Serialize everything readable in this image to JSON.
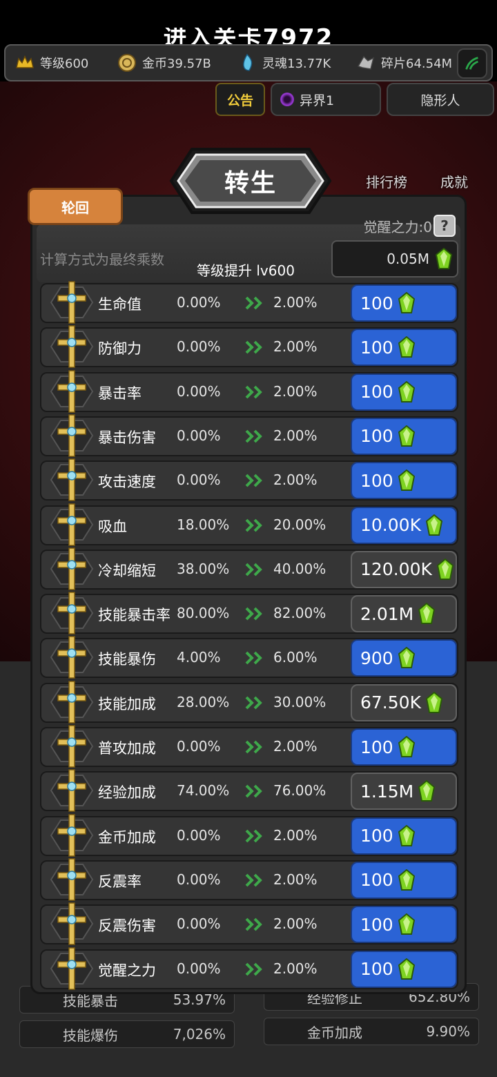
{
  "header": {
    "stage_title": "进入关卡7972"
  },
  "resources": [
    {
      "icon": "crown-icon",
      "label": "等级600"
    },
    {
      "icon": "gold-coin-icon",
      "label": "金币39.57B"
    },
    {
      "icon": "soul-icon",
      "label": "灵魂13.77K"
    },
    {
      "icon": "shard-icon",
      "label": "碎片64.54M"
    }
  ],
  "top_tabs": {
    "notice": "公告",
    "other_world": "异界1",
    "invisible": "隐形人"
  },
  "side": {
    "leaderboard": "排行榜",
    "achievement": "成就"
  },
  "panel": {
    "title": "转生",
    "tab": "轮回",
    "awaken_power": "觉醒之力:0",
    "help": "?",
    "calc_note": "计算方式为最终乘数",
    "level_up": "等级提升 lv600",
    "level_cost": "0.05M"
  },
  "stats": [
    {
      "name": "生命值",
      "from": "0.00%",
      "to": "2.00%",
      "cost": "100",
      "style": "blue"
    },
    {
      "name": "防御力",
      "from": "0.00%",
      "to": "2.00%",
      "cost": "100",
      "style": "blue"
    },
    {
      "name": "暴击率",
      "from": "0.00%",
      "to": "2.00%",
      "cost": "100",
      "style": "blue"
    },
    {
      "name": "暴击伤害",
      "from": "0.00%",
      "to": "2.00%",
      "cost": "100",
      "style": "blue"
    },
    {
      "name": "攻击速度",
      "from": "0.00%",
      "to": "2.00%",
      "cost": "100",
      "style": "blue"
    },
    {
      "name": "吸血",
      "from": "18.00%",
      "to": "20.00%",
      "cost": "10.00K",
      "style": "blue"
    },
    {
      "name": "冷却缩短",
      "from": "38.00%",
      "to": "40.00%",
      "cost": "120.00K",
      "style": "gray"
    },
    {
      "name": "技能暴击率",
      "from": "80.00%",
      "to": "82.00%",
      "cost": "2.01M",
      "style": "gray"
    },
    {
      "name": "技能暴伤",
      "from": "4.00%",
      "to": "6.00%",
      "cost": "900",
      "style": "blue"
    },
    {
      "name": "技能加成",
      "from": "28.00%",
      "to": "30.00%",
      "cost": "67.50K",
      "style": "gray"
    },
    {
      "name": "普攻加成",
      "from": "0.00%",
      "to": "2.00%",
      "cost": "100",
      "style": "blue"
    },
    {
      "name": "经验加成",
      "from": "74.00%",
      "to": "76.00%",
      "cost": "1.15M",
      "style": "gray"
    },
    {
      "name": "金币加成",
      "from": "0.00%",
      "to": "2.00%",
      "cost": "100",
      "style": "blue"
    },
    {
      "name": "反震率",
      "from": "0.00%",
      "to": "2.00%",
      "cost": "100",
      "style": "blue"
    },
    {
      "name": "反震伤害",
      "from": "0.00%",
      "to": "2.00%",
      "cost": "100",
      "style": "blue"
    },
    {
      "name": "觉醒之力",
      "from": "0.00%",
      "to": "2.00%",
      "cost": "100",
      "style": "blue"
    }
  ],
  "background_stats": [
    {
      "label": "技能暴击",
      "value": "53.97%"
    },
    {
      "label": "技能爆伤",
      "value": "7,026%"
    },
    {
      "label": "经验修正",
      "value": "652.80%"
    },
    {
      "label": "金币加成",
      "value": "9.90%"
    }
  ],
  "colors": {
    "button_blue": "#2b63d5",
    "button_gray": "#3e3e3e",
    "tab_orange": "#d6833c",
    "notice_gold": "#f1cc3b",
    "gem_green": "#7ed321"
  }
}
